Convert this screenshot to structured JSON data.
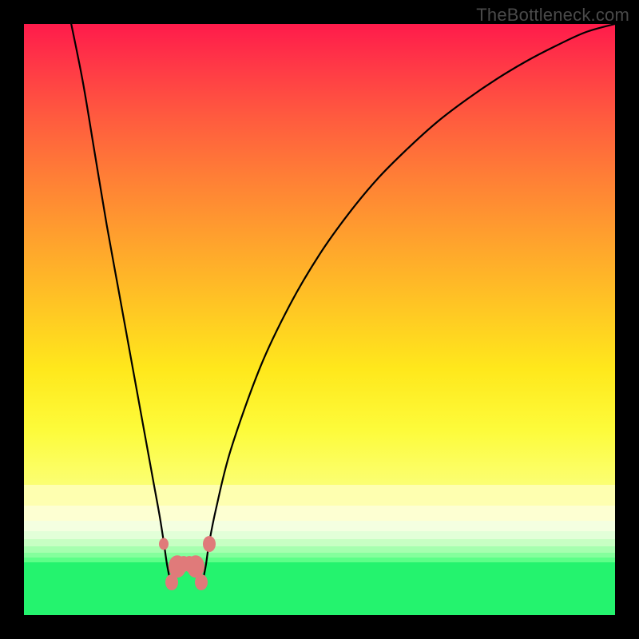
{
  "watermark": "TheBottleneck.com",
  "chart_data": {
    "type": "line",
    "title": "",
    "xlabel": "",
    "ylabel": "",
    "xlim": [
      0,
      100
    ],
    "ylim": [
      0,
      100
    ],
    "series": [
      {
        "name": "bottleneck-curve",
        "points": [
          [
            8.0,
            100.0
          ],
          [
            10.0,
            90.0
          ],
          [
            12.0,
            78.0
          ],
          [
            14.0,
            66.0
          ],
          [
            16.0,
            55.0
          ],
          [
            18.0,
            44.0
          ],
          [
            20.0,
            33.0
          ],
          [
            21.0,
            27.5
          ],
          [
            22.0,
            22.0
          ],
          [
            23.0,
            16.5
          ],
          [
            23.7,
            12.0
          ],
          [
            24.3,
            8.0
          ],
          [
            25.0,
            5.5
          ],
          [
            26.0,
            8.2
          ],
          [
            27.0,
            8.7
          ],
          [
            28.0,
            8.7
          ],
          [
            29.0,
            8.2
          ],
          [
            30.0,
            5.5
          ],
          [
            30.7,
            8.0
          ],
          [
            31.3,
            12.0
          ],
          [
            32.5,
            18.0
          ],
          [
            35.0,
            28.0
          ],
          [
            40.0,
            42.0
          ],
          [
            45.0,
            52.5
          ],
          [
            50.0,
            61.0
          ],
          [
            55.0,
            68.0
          ],
          [
            60.0,
            74.0
          ],
          [
            65.0,
            79.0
          ],
          [
            70.0,
            83.5
          ],
          [
            75.0,
            87.3
          ],
          [
            80.0,
            90.7
          ],
          [
            85.0,
            93.7
          ],
          [
            90.0,
            96.3
          ],
          [
            95.0,
            98.6
          ],
          [
            100.0,
            100.0
          ]
        ]
      }
    ],
    "markers": [
      {
        "x": 23.7,
        "y": 12.0,
        "size": "small"
      },
      {
        "x": 25.0,
        "y": 5.5,
        "size": "medium"
      },
      {
        "x": 26.0,
        "y": 8.2,
        "size": "large"
      },
      {
        "x": 27.0,
        "y": 8.7,
        "size": "medium"
      },
      {
        "x": 28.0,
        "y": 8.7,
        "size": "medium"
      },
      {
        "x": 29.0,
        "y": 8.2,
        "size": "large"
      },
      {
        "x": 30.0,
        "y": 5.5,
        "size": "medium"
      },
      {
        "x": 31.3,
        "y": 12.0,
        "size": "medium"
      }
    ],
    "marker_color": "#e07a7a",
    "curve_color": "#000000",
    "gradient_stops": [
      {
        "pct": 0,
        "color": "#ff1b4b"
      },
      {
        "pct": 78,
        "color": "#fbff72"
      },
      {
        "pct": 92,
        "color": "#24f36e"
      }
    ]
  }
}
